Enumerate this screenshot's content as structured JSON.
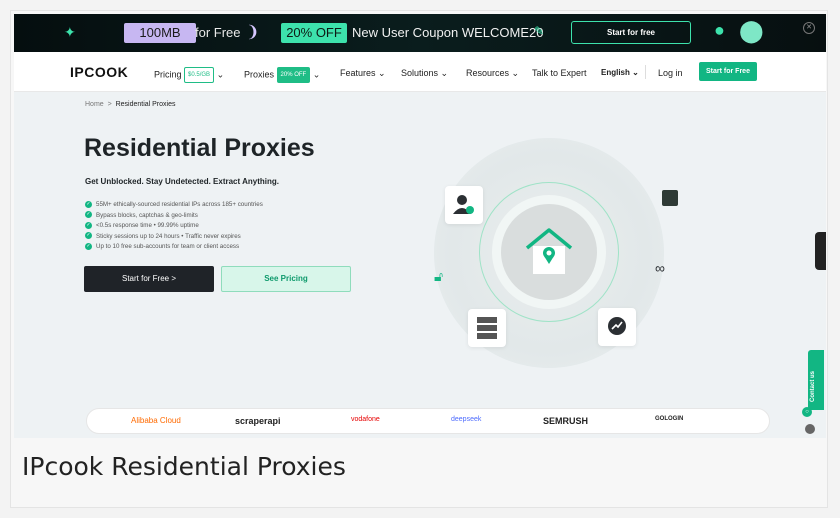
{
  "promo": {
    "storage_label": "100MB",
    "for_free": "for Free",
    "discount": "20% OFF",
    "coupon_text": "New User Coupon WELCOME20",
    "start_label": "Start for free"
  },
  "nav": {
    "logo": "IPCOOK",
    "pricing": "Pricing",
    "pricing_badge": "$0.5/GB",
    "proxies": "Proxies",
    "proxies_badge": "20% OFF",
    "features": "Features",
    "solutions": "Solutions",
    "resources": "Resources",
    "talk": "Talk to Expert",
    "language": "English",
    "login": "Log in",
    "cta": "Start for Free"
  },
  "breadcrumb": {
    "home": "Home",
    "separator": ">",
    "current": "Residential Proxies"
  },
  "hero": {
    "title": "Residential Proxies",
    "subtitle": "Get Unblocked. Stay Undetected. Extract Anything.",
    "features": [
      "55M+ ethically-sourced residential IPs across 185+ countries",
      "Bypass blocks, captchas & geo-limits",
      "<0.5s response time • 99.99% uptime",
      "Sticky sessions up to 24 hours • Traffic never expires",
      "Up to 10 free sub-accounts for team or client access"
    ],
    "primary_button": "Start for Free  >",
    "secondary_button": "See Pricing"
  },
  "partners": [
    "Alibaba Cloud",
    "scraperapi",
    "vodafone",
    "deepseek",
    "SEMRUSH",
    "GOLOGIN"
  ],
  "side": {
    "contact": "Contact us"
  },
  "caption": "IPcook Residential Proxies",
  "colors": {
    "accent": "#12b683",
    "dark": "#1f2328",
    "banner_bg": "#050e0f",
    "lavender": "#c7b7f2",
    "mint": "#3de2ac"
  }
}
